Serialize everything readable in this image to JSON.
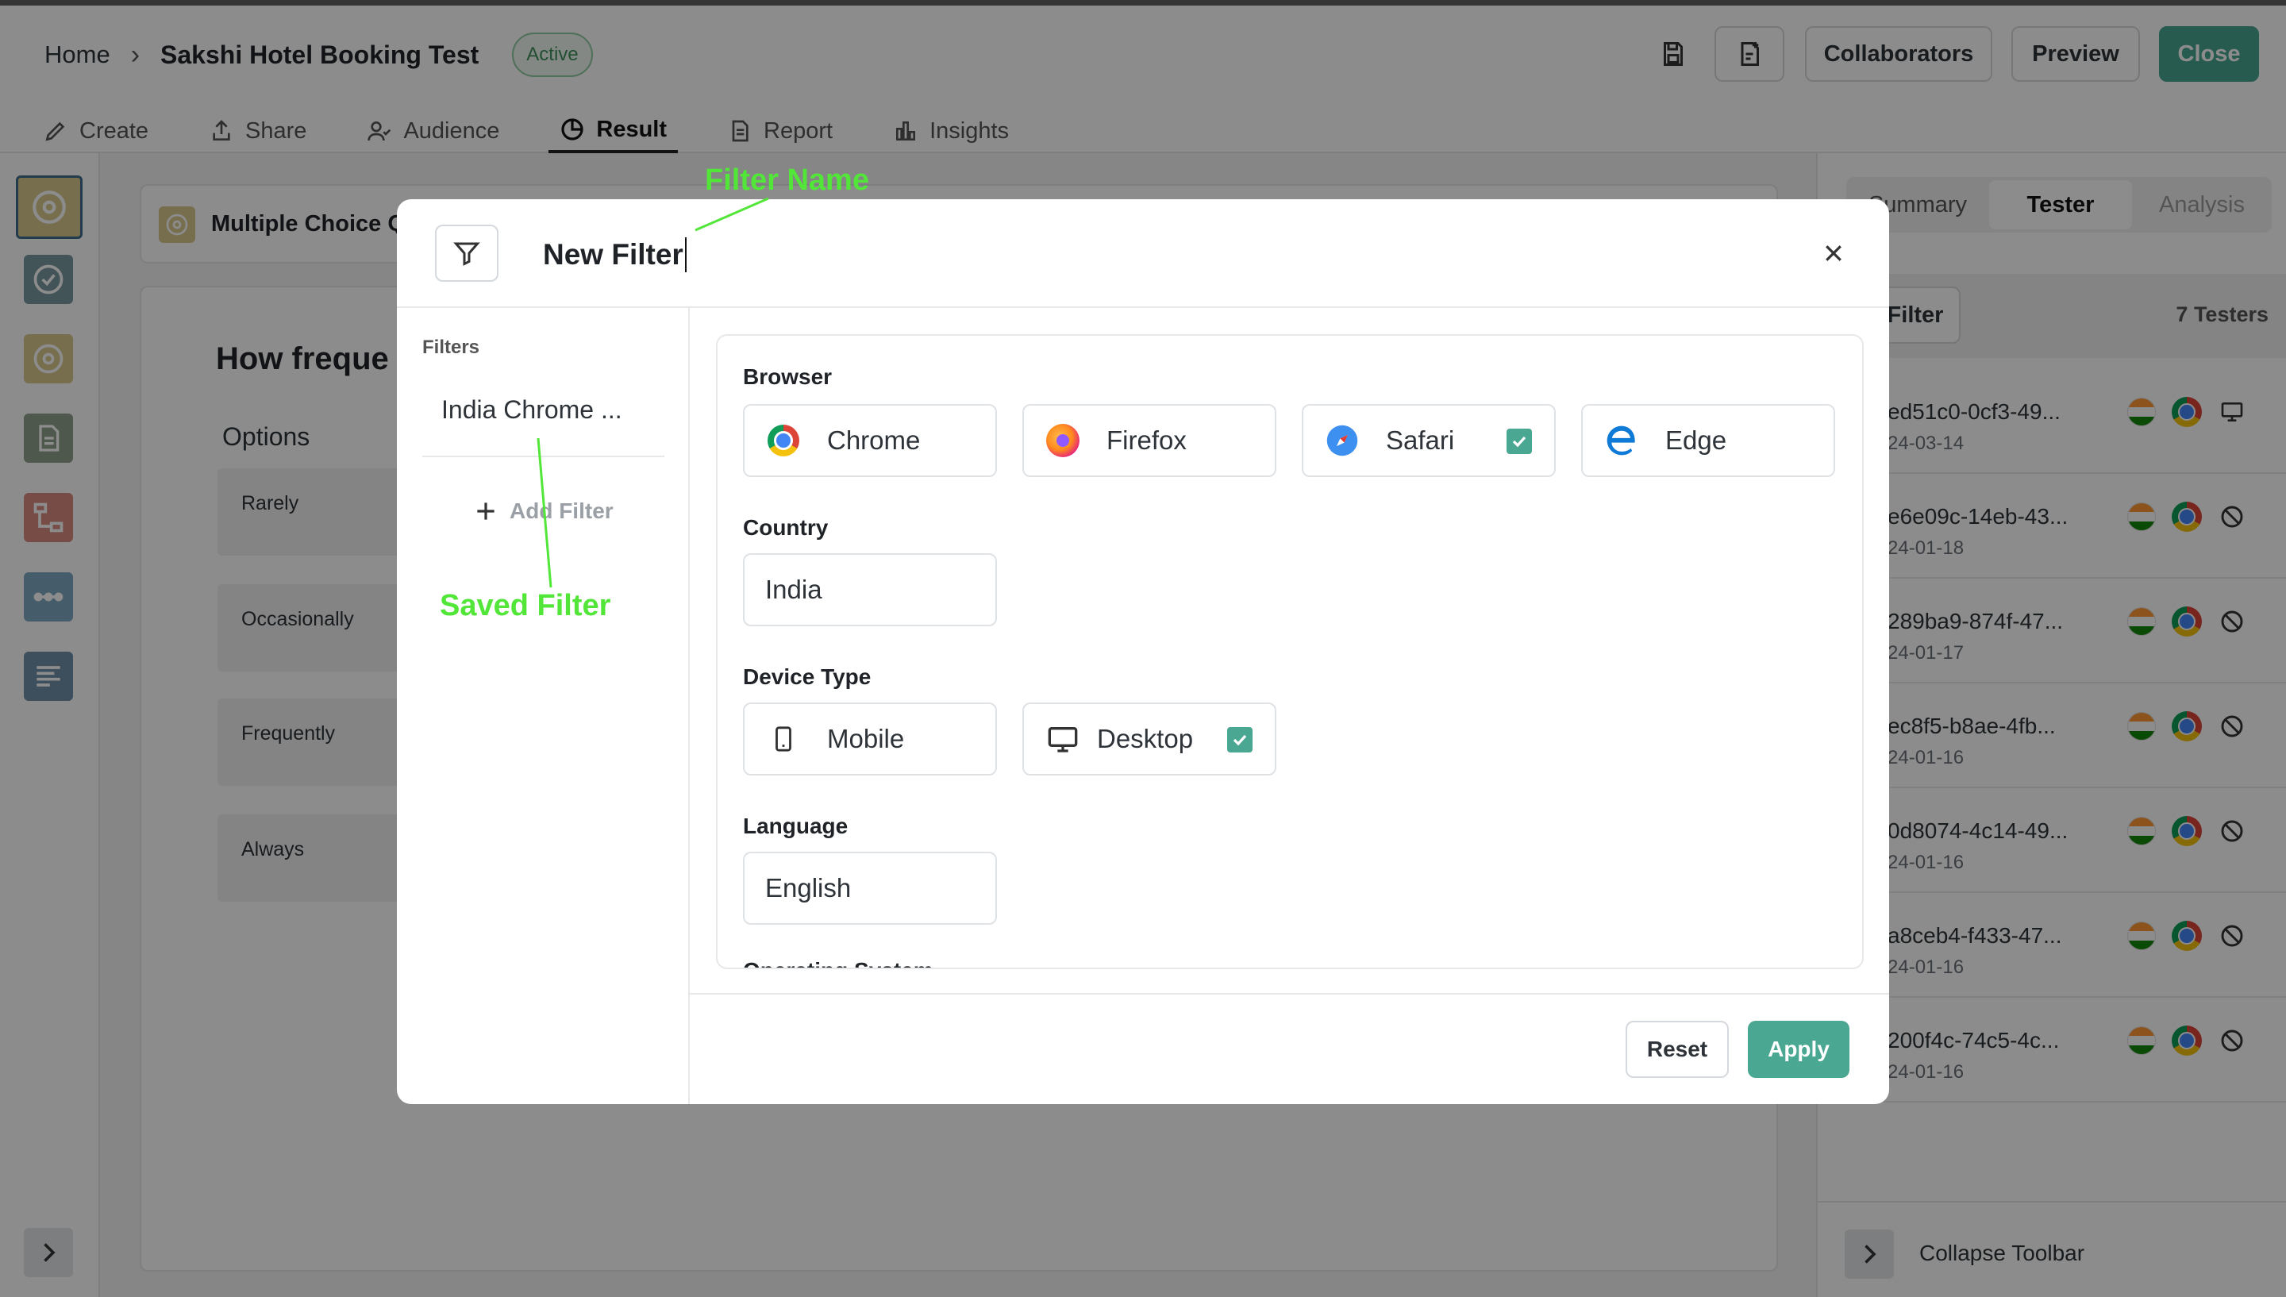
{
  "header": {
    "home": "Home",
    "separator": "›",
    "title": "Sakshi Hotel Booking Test",
    "status": "Active",
    "buttons": {
      "collaborators": "Collaborators",
      "preview": "Preview",
      "close": "Close"
    }
  },
  "tabs": [
    {
      "label": "Create",
      "icon": "pencil-icon"
    },
    {
      "label": "Share",
      "icon": "share-icon"
    },
    {
      "label": "Audience",
      "icon": "audience-icon"
    },
    {
      "label": "Result",
      "icon": "pie-chart-icon",
      "active": true
    },
    {
      "label": "Report",
      "icon": "report-icon"
    },
    {
      "label": "Insights",
      "icon": "bar-chart-icon"
    }
  ],
  "main": {
    "block_label": "Multiple Choice Q",
    "question": "How freque",
    "options_heading": "Options",
    "options": [
      "Rarely",
      "Occasionally",
      "Frequently",
      "Always"
    ]
  },
  "right_panel": {
    "tabs": [
      "Summary",
      "Tester",
      "Analysis"
    ],
    "active_tab": "Tester",
    "filter_button": "Filter",
    "tester_count": "7 Testers",
    "testers": [
      {
        "id": "ed51c0-0cf3-49...",
        "date": "24-03-14",
        "device": "desktop"
      },
      {
        "id": "e6e09c-14eb-43...",
        "date": "24-01-18",
        "device": "unavailable"
      },
      {
        "id": "289ba9-874f-47...",
        "date": "24-01-17",
        "device": "unavailable"
      },
      {
        "id": "ec8f5-b8ae-4fb...",
        "date": "24-01-16",
        "device": "unavailable"
      },
      {
        "id": "0d8074-4c14-49...",
        "date": "24-01-16",
        "device": "unavailable"
      },
      {
        "id": "a8ceb4-f433-47...",
        "date": "24-01-16",
        "device": "unavailable"
      },
      {
        "id": "200f4c-74c5-4c...",
        "date": "24-01-16",
        "device": "unavailable"
      }
    ],
    "collapse": "Collapse Toolbar"
  },
  "modal": {
    "filter_name": "New Filter",
    "sidebar_label": "Filters",
    "saved_filter": "India Chrome ...",
    "add_filter": "Add Filter",
    "sections": {
      "browser": {
        "label": "Browser",
        "options": [
          {
            "label": "Chrome",
            "checked": false
          },
          {
            "label": "Firefox",
            "checked": false
          },
          {
            "label": "Safari",
            "checked": true
          },
          {
            "label": "Edge",
            "checked": false
          }
        ]
      },
      "country": {
        "label": "Country",
        "options": [
          {
            "label": "India",
            "checked": false
          }
        ]
      },
      "device": {
        "label": "Device Type",
        "options": [
          {
            "label": "Mobile",
            "checked": false
          },
          {
            "label": "Desktop",
            "checked": true
          }
        ]
      },
      "language": {
        "label": "Language",
        "options": [
          {
            "label": "English",
            "checked": false
          }
        ]
      },
      "next_section_partial": "Operating System"
    },
    "reset": "Reset",
    "apply": "Apply"
  },
  "annotations": {
    "filter_name": "Filter Name",
    "saved_filter": "Saved Filter"
  },
  "colors": {
    "accent": "#4aa792",
    "annotation": "#52e639",
    "active_badge": "#3e8e5a"
  }
}
